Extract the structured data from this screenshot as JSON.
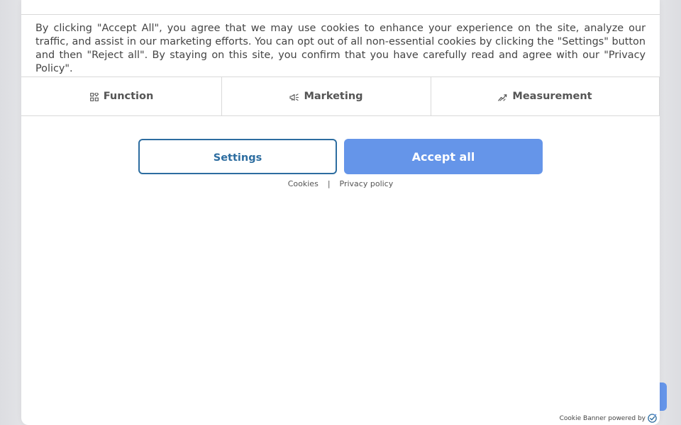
{
  "banner": {
    "text": "By clicking \"Accept All\", you agree that we may use cookies to enhance your experience on the site, analyze our traffic, and assist in our marketing efforts. You can opt out of all non-essential cookies by clicking the \"Settings\" button and then \"Reject all\". By staying on this site, you confirm that you have carefully read and agree with our \"Privacy Policy\".",
    "categories": [
      {
        "label": "Function",
        "icon": "grid-icon"
      },
      {
        "label": "Marketing",
        "icon": "megaphone-icon"
      },
      {
        "label": "Measurement",
        "icon": "trend-chart-icon"
      }
    ],
    "buttons": {
      "settings_label": "Settings",
      "accept_label": "Accept all"
    },
    "links": {
      "cookies": "Cookies",
      "separator": "|",
      "privacy": "Privacy policy"
    },
    "powered_by": "Cookie Banner powered by"
  },
  "colors": {
    "accent": "#6595e9",
    "outline": "#2d6da0",
    "text": "#444444"
  }
}
